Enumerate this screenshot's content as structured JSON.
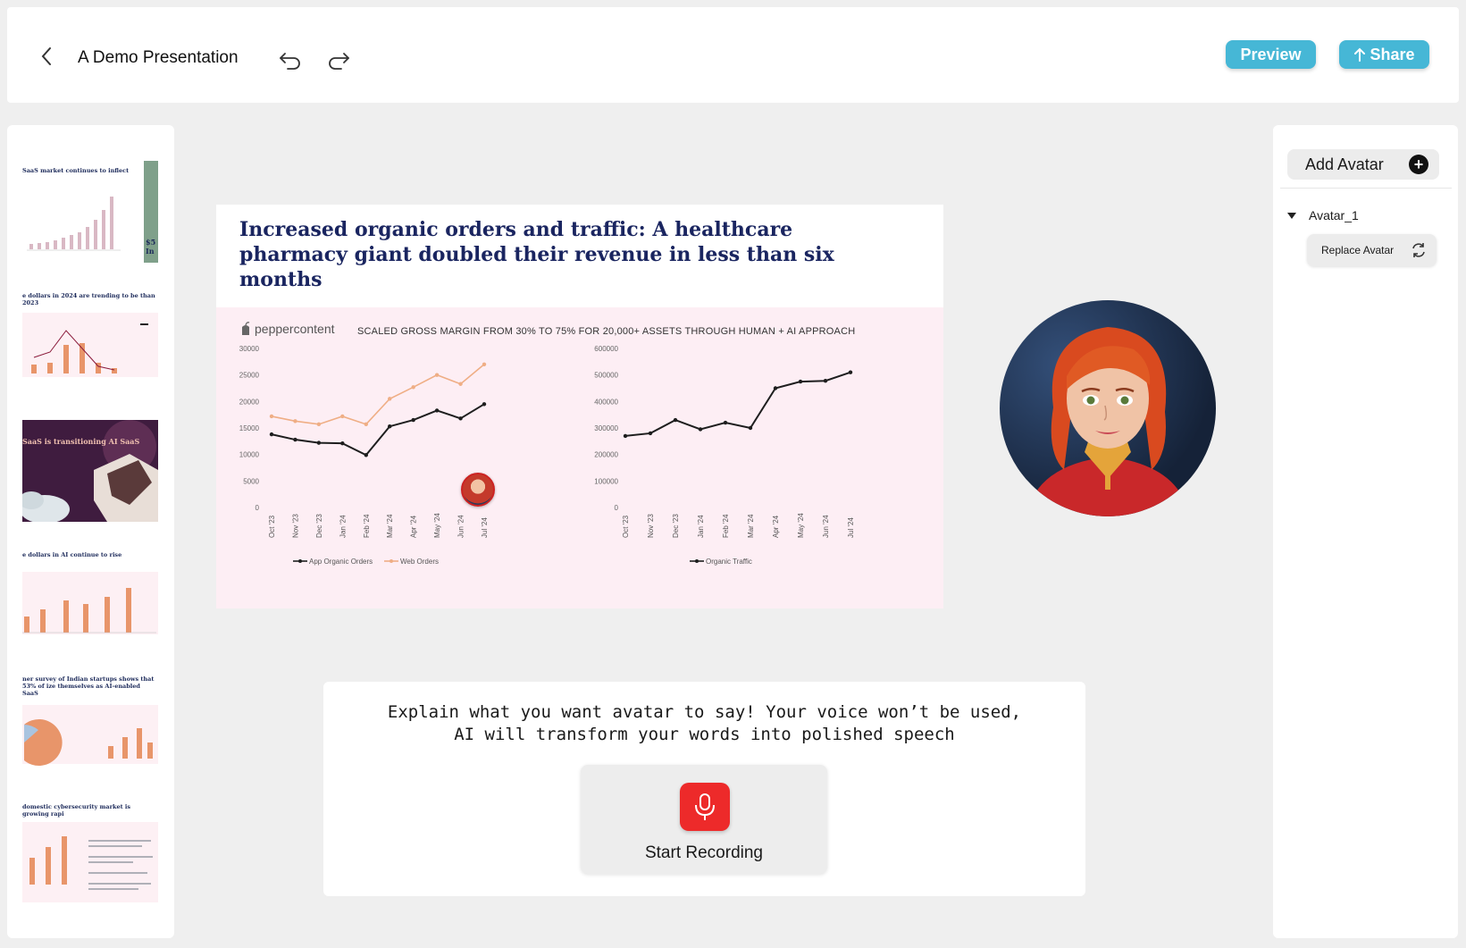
{
  "header": {
    "title": "A Demo Presentation",
    "preview_label": "Preview",
    "share_label": "Share",
    "accent": "#46b7d6"
  },
  "thumbnails": [
    {
      "title": "SaaS market continues to inflect",
      "side_text": "$5 In"
    },
    {
      "title": "e dollars in 2024 are trending to be than 2023"
    },
    {
      "title": "SaaS is transitioning AI SaaS"
    },
    {
      "title": "e dollars in AI continue to rise"
    },
    {
      "title": "ner survey of Indian startups shows that 53% of ize themselves as AI-enabled SaaS"
    },
    {
      "title": "domestic cybersecurity market is growing rapi"
    }
  ],
  "slide": {
    "title": "Increased organic orders and traffic: A healthcare pharmacy giant doubled their revenue in less than six months",
    "brand": "peppercontent",
    "caption": "SCALED GROSS MARGIN FROM 30% TO 75% FOR 20,000+ ASSETS THROUGH HUMAN + AI APPROACH"
  },
  "chart_data": [
    {
      "type": "line",
      "categories": [
        "Oct '23",
        "Nov '23",
        "Dec '23",
        "Jan '24",
        "Feb '24",
        "Mar '24",
        "Apr '24",
        "May '24",
        "Jun '24",
        "Jul '24"
      ],
      "ylim": [
        0,
        30000
      ],
      "yticks": [
        "0",
        "5000",
        "10000",
        "15000",
        "20000",
        "25000",
        "30000"
      ],
      "series": [
        {
          "name": "App Organic Orders",
          "color": "#1e1e1e",
          "values": [
            13800,
            12800,
            12200,
            12100,
            9900,
            15300,
            16500,
            18300,
            16800,
            19500
          ]
        },
        {
          "name": "Web Orders",
          "color": "#efae85",
          "values": [
            17200,
            16300,
            15700,
            17200,
            15700,
            20500,
            22700,
            25000,
            23300,
            27000
          ]
        }
      ]
    },
    {
      "type": "line",
      "categories": [
        "Oct '23",
        "Nov '23",
        "Dec '23",
        "Jan '24",
        "Feb '24",
        "Mar '24",
        "Apr '24",
        "May '24",
        "Jun '24",
        "Jul '24"
      ],
      "ylim": [
        0,
        600000
      ],
      "yticks": [
        "0",
        "100000",
        "200000",
        "300000",
        "400000",
        "500000",
        "600000"
      ],
      "series": [
        {
          "name": "Organic Traffic",
          "color": "#1e1e1e",
          "values": [
            270000,
            280000,
            330000,
            295000,
            320000,
            300000,
            450000,
            475000,
            478000,
            510000
          ]
        }
      ]
    }
  ],
  "right_panel": {
    "add_avatar_label": "Add Avatar",
    "avatar_name": "Avatar_1",
    "replace_label": "Replace Avatar"
  },
  "recording": {
    "instructions": "Explain what you want avatar to say! Your voice won’t be used,\nAI will transform your words into polished speech",
    "button_label": "Start Recording",
    "button_color": "#ed2a2a"
  }
}
